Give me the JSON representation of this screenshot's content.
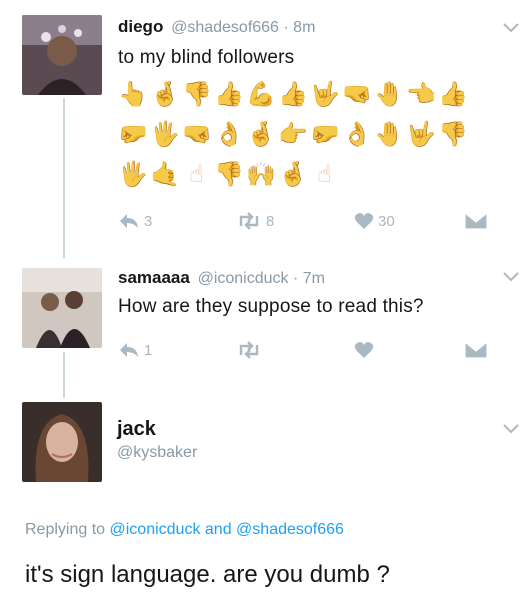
{
  "tweets": [
    {
      "display_name": "diego",
      "handle": "@shadesof666",
      "separator": " · ",
      "time": "8m",
      "text": "to my blind followers",
      "emoji_rows": [
        [
          "👆",
          "🤞",
          "👎",
          "👍",
          "💪",
          "👍",
          "🤟",
          "🤜",
          "🤚",
          "👈",
          "👍"
        ],
        [
          "🤛",
          "🖐",
          "🤜",
          "👌",
          "🤞",
          "👉",
          "🤛",
          "👌",
          "🤚",
          "🤟",
          "👎"
        ],
        [
          "🖐",
          "🤙",
          "☝",
          "👎",
          "🙌",
          "🤞",
          "☝"
        ]
      ],
      "actions": {
        "reply_count": "3",
        "retweet_count": "8",
        "like_count": "30"
      }
    },
    {
      "display_name": "samaaaa",
      "handle": "@iconicduck",
      "separator": " · ",
      "time": "7m",
      "text": "How are they suppose to read this?",
      "actions": {
        "reply_count": "1",
        "retweet_count": "",
        "like_count": ""
      }
    },
    {
      "display_name": "jack",
      "handle": "@kysbaker",
      "replying_prefix": "Replying to ",
      "replying_mention_1": "@iconicduck",
      "replying_and": " and ",
      "replying_mention_2": "@shadesof666",
      "text": "it's sign language. are you dumb ?"
    }
  ],
  "icons": {
    "reply": "reply-icon",
    "retweet": "retweet-icon",
    "like": "heart-icon",
    "dm": "direct-message-icon",
    "menu": "chevron-down-icon"
  },
  "colors": {
    "text": "#14171a",
    "muted": "#8899a6",
    "icon": "#aab8c2",
    "link": "#1da1f2",
    "thread_line": "#ccd6dd",
    "emoji_skin": "#e2b88f"
  }
}
